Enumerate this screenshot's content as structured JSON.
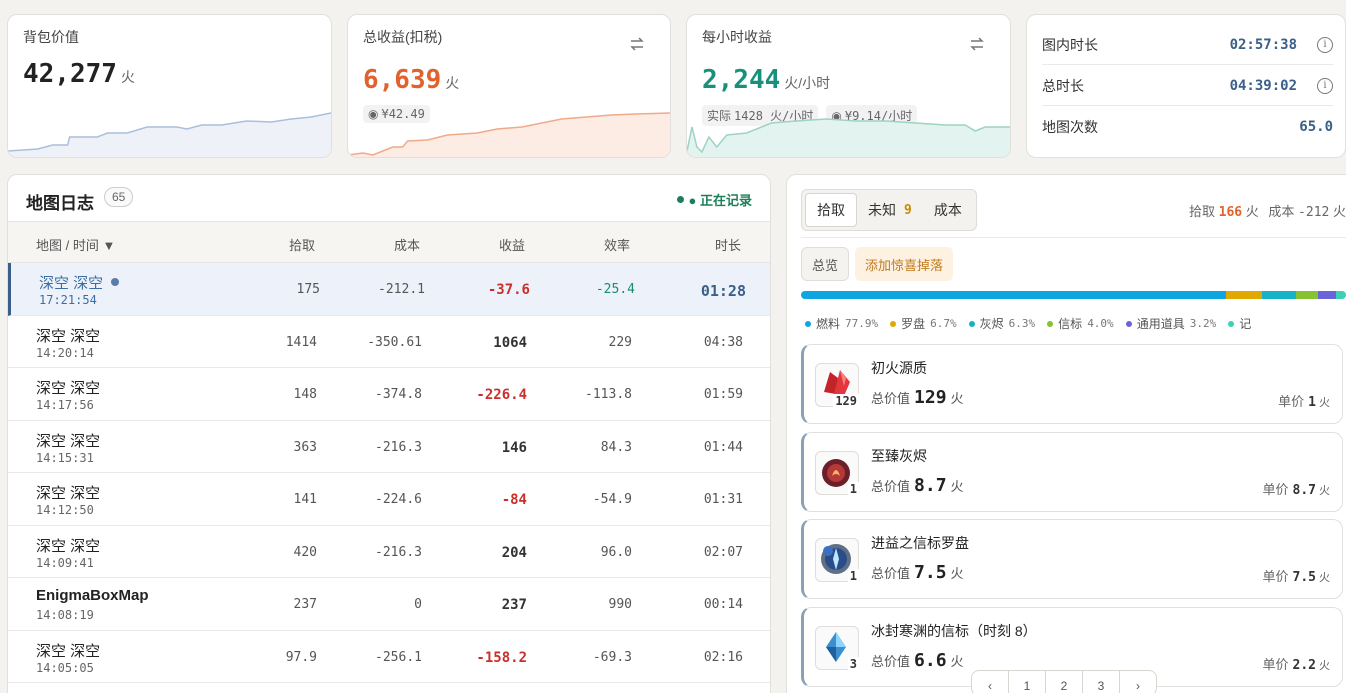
{
  "stats": {
    "bag": {
      "label": "背包价值",
      "value": "42,277",
      "unit": "火"
    },
    "income": {
      "label": "总收益(扣税)",
      "value": "6,639",
      "unit": "火",
      "rmb": "¥42.49"
    },
    "hourly": {
      "label": "每小时收益",
      "value": "2,244",
      "unit": "火/小时",
      "actual_label": "实际",
      "actual_value": "1428 火/小时",
      "rmb": "¥9.14/小时"
    },
    "times": [
      {
        "label": "图内时长",
        "value": "02:57:38",
        "info": "i"
      },
      {
        "label": "总时长",
        "value": "04:39:02",
        "info": "i"
      },
      {
        "label": "地图次数",
        "value": "65.0"
      }
    ]
  },
  "maplog": {
    "title": "地图日志",
    "count": "65",
    "status": "● 正在记录",
    "columns": [
      "地图 / 时间 ▼",
      "拾取",
      "成本",
      "收益",
      "效率",
      "时长"
    ],
    "rows": [
      {
        "name": "深空 深空",
        "time": "17:21:54",
        "pickup": "175",
        "cost": "-212.1",
        "profit": "-37.6",
        "eff": "-25.4",
        "dur": "01:28",
        "neg": true
      },
      {
        "name": "深空 深空",
        "time": "14:20:14",
        "pickup": "1414",
        "cost": "-350.61",
        "profit": "1064",
        "eff": "229",
        "dur": "04:38",
        "neg": false
      },
      {
        "name": "深空 深空",
        "time": "14:17:56",
        "pickup": "148",
        "cost": "-374.8",
        "profit": "-226.4",
        "eff": "-113.8",
        "dur": "01:59",
        "neg": true
      },
      {
        "name": "深空 深空",
        "time": "14:15:31",
        "pickup": "363",
        "cost": "-216.3",
        "profit": "146",
        "eff": "84.3",
        "dur": "01:44",
        "neg": false
      },
      {
        "name": "深空 深空",
        "time": "14:12:50",
        "pickup": "141",
        "cost": "-224.6",
        "profit": "-84",
        "eff": "-54.9",
        "dur": "01:31",
        "neg": true
      },
      {
        "name": "深空 深空",
        "time": "14:09:41",
        "pickup": "420",
        "cost": "-216.3",
        "profit": "204",
        "eff": "96.0",
        "dur": "02:07",
        "neg": false
      },
      {
        "name": "EnigmaBoxMap",
        "time": "14:08:19",
        "pickup": "237",
        "cost": "0",
        "profit": "237",
        "eff": "990",
        "dur": "00:14",
        "neg": false
      },
      {
        "name": "深空 深空",
        "time": "14:05:05",
        "pickup": "97.9",
        "cost": "-256.1",
        "profit": "-158.2",
        "eff": "-69.3",
        "dur": "02:16",
        "neg": true
      }
    ]
  },
  "detail": {
    "tabs": [
      {
        "label": "拾取",
        "count": ""
      },
      {
        "label": "未知",
        "count": "9"
      },
      {
        "label": "成本",
        "count": ""
      }
    ],
    "summary": {
      "pickup_label": "拾取",
      "pickup_value": "166",
      "cost_label": "成本",
      "cost_value": "-212",
      "unit": "火"
    },
    "filters": [
      "总览",
      "添加惊喜掉落"
    ],
    "distribution": [
      {
        "name": "燃料",
        "pct": "77.9%",
        "value": 77.9,
        "color": "#0ea5e0"
      },
      {
        "name": "罗盘",
        "pct": "6.7%",
        "value": 6.7,
        "color": "#e0a800"
      },
      {
        "name": "灰烬",
        "pct": "6.3%",
        "value": 6.3,
        "color": "#17b2c8"
      },
      {
        "name": "信标",
        "pct": "4.0%",
        "value": 4.0,
        "color": "#86c232"
      },
      {
        "name": "通用道具",
        "pct": "3.2%",
        "value": 3.2,
        "color": "#6a63d9"
      },
      {
        "name": "记",
        "pct": "",
        "value": 1.9,
        "color": "#3ecfb5"
      }
    ],
    "items": [
      {
        "name": "初火源质",
        "qty": "129",
        "total_label": "总价值",
        "total": "129",
        "unit": "火",
        "price_label": "单价",
        "price": "1",
        "icon": "crimson-crystal-icon"
      },
      {
        "name": "至臻灰烬",
        "qty": "1",
        "total_label": "总价值",
        "total": "8.7",
        "unit": "火",
        "price_label": "单价",
        "price": "8.7",
        "icon": "ember-gem-icon"
      },
      {
        "name": "进益之信标罗盘",
        "qty": "1",
        "total_label": "总价值",
        "total": "7.5",
        "unit": "火",
        "price_label": "单价",
        "price": "7.5",
        "icon": "compass-icon"
      },
      {
        "name": "冰封寒渊的信标（时刻 8）",
        "qty": "3",
        "total_label": "总价值",
        "total": "6.6",
        "unit": "火",
        "price_label": "单价",
        "price": "2.2",
        "icon": "ice-beacon-icon"
      }
    ],
    "pager": [
      "‹",
      "1",
      "2",
      "3",
      "›"
    ]
  }
}
